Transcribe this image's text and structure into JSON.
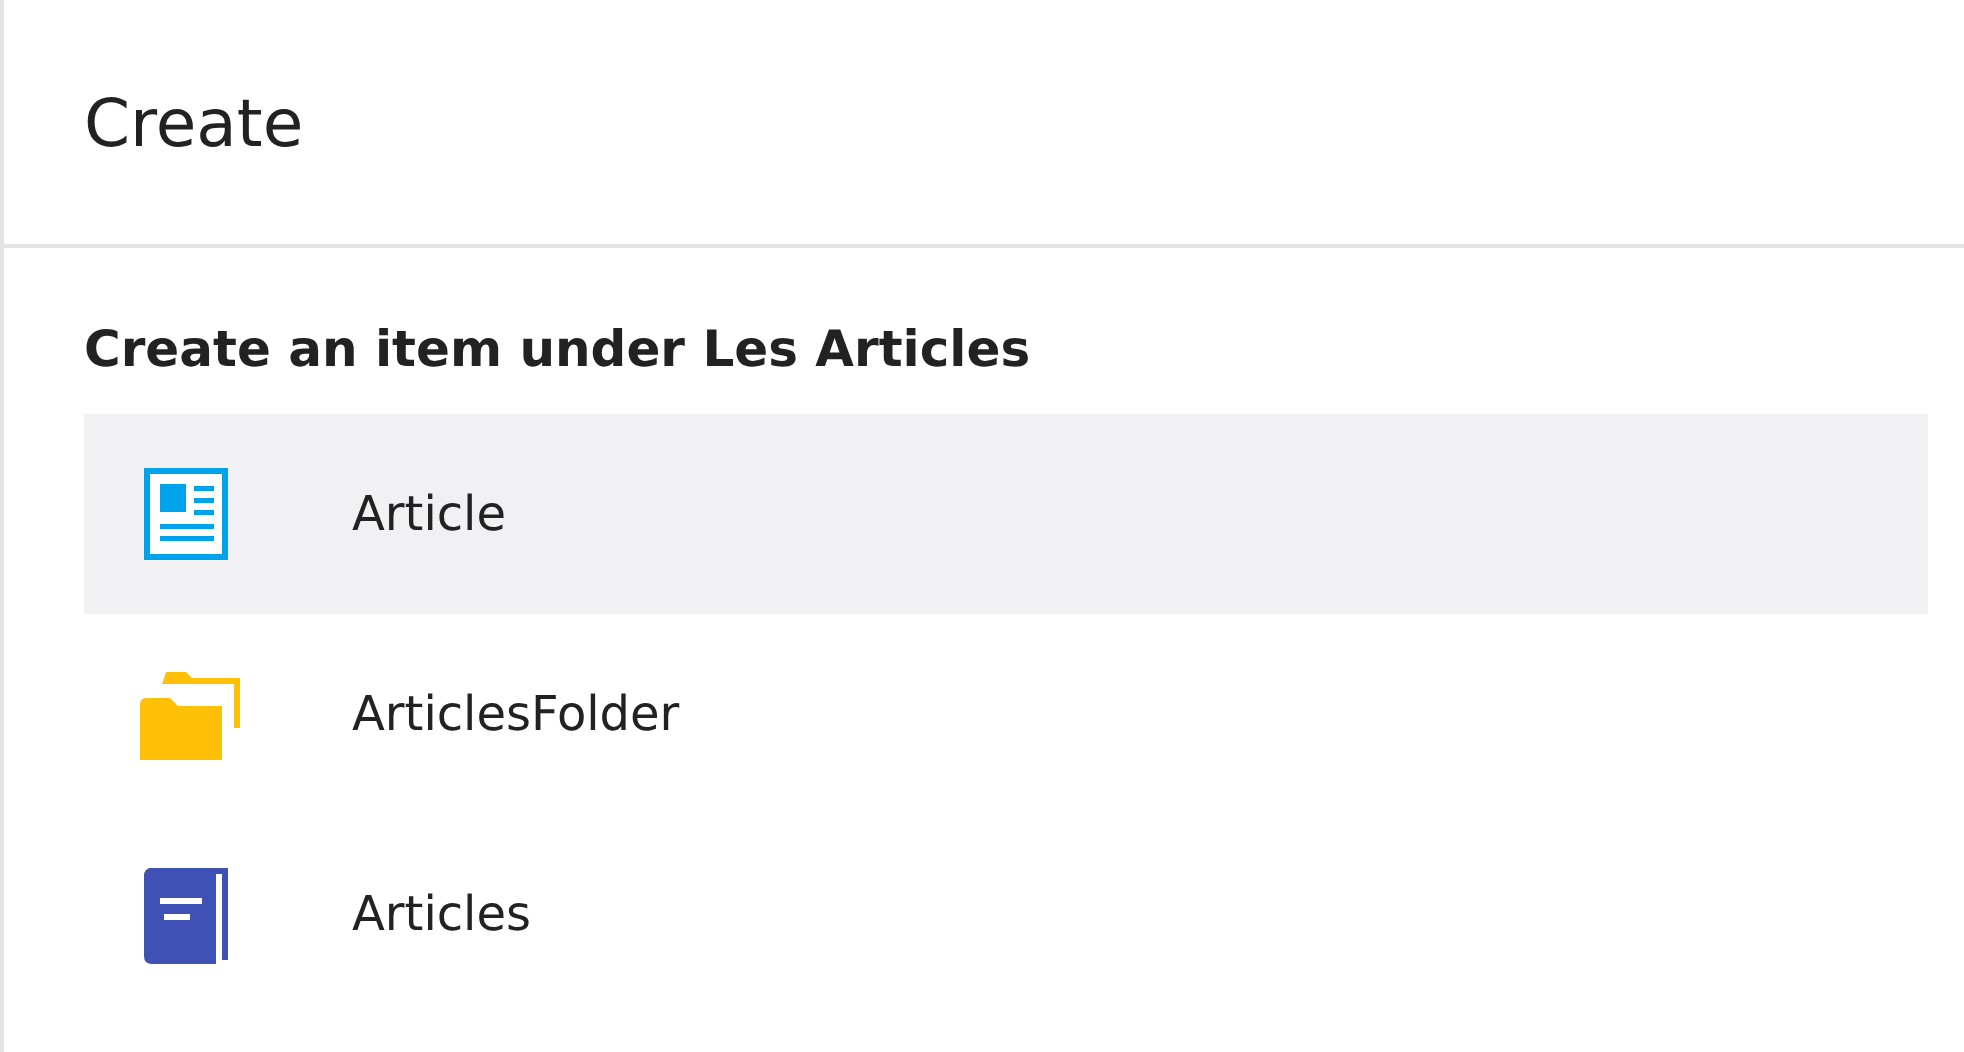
{
  "header": {
    "title": "Create"
  },
  "section": {
    "heading": "Create an item under Les Articles"
  },
  "items": [
    {
      "label": "Article",
      "kind": "article",
      "selected": true
    },
    {
      "label": "ArticlesFolder",
      "kind": "folder",
      "selected": false
    },
    {
      "label": "Articles",
      "kind": "book",
      "selected": false
    }
  ]
}
